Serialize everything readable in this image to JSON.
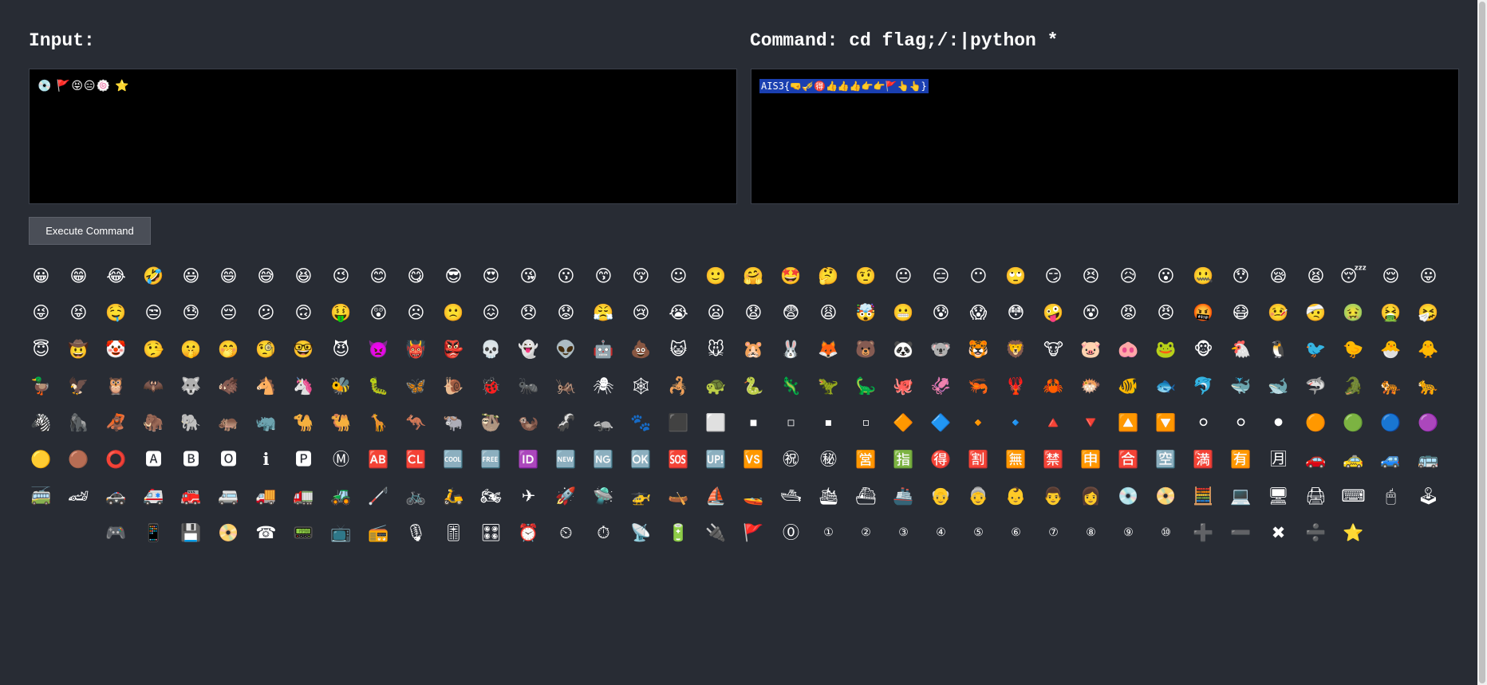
{
  "input_panel": {
    "title": "Input:",
    "value": "💿 🚩😝😑🍥 ⭐"
  },
  "command_panel": {
    "title": "Command: cd flag;/:|python *",
    "output": "AIS3{🤜🎺🉐👍👍👍👉👉🚩👆👆}"
  },
  "execute_button": {
    "label": "Execute Command"
  },
  "emoji_grid": [
    "😀",
    "😁",
    "😂",
    "🤣",
    "😃",
    "😄",
    "😅",
    "😆",
    "😉",
    "😊",
    "😋",
    "😎",
    "😍",
    "😘",
    "😗",
    "😙",
    "😚",
    "☺",
    "🙂",
    "🤗",
    "🤩",
    "🤔",
    "🤨",
    "😐",
    "😑",
    "😶",
    "🙄",
    "😏",
    "😣",
    "😥",
    "😮",
    "🤐",
    "😯",
    "😪",
    "😫",
    "😴",
    "😌",
    "😛",
    "😜",
    "😝",
    "🤤",
    "😒",
    "😓",
    "😔",
    "😕",
    "🙃",
    "🤑",
    "😲",
    "☹",
    "🙁",
    "😖",
    "😞",
    "😟",
    "😤",
    "😢",
    "😭",
    "😦",
    "😧",
    "😨",
    "😩",
    "🤯",
    "😬",
    "😰",
    "😱",
    "😳",
    "🤪",
    "😵",
    "😡",
    "😠",
    "🤬",
    "😷",
    "🤒",
    "🤕",
    "🤢",
    "🤮",
    "🤧",
    "😇",
    "🤠",
    "🤡",
    "🤥",
    "🤫",
    "🤭",
    "🧐",
    "🤓",
    "😈",
    "👿",
    "👹",
    "👺",
    "💀",
    "👻",
    "👽",
    "🤖",
    "💩",
    "😺",
    "🐭",
    "🐹",
    "🐰",
    "🦊",
    "🐻",
    "🐼",
    "🐨",
    "🐯",
    "🦁",
    "🐮",
    "🐷",
    "🐽",
    "🐸",
    "🐵",
    "🐔",
    "🐧",
    "🐦",
    "🐤",
    "🐣",
    "🐥",
    "🦆",
    "🦅",
    "🦉",
    "🦇",
    "🐺",
    "🐗",
    "🐴",
    "🦄",
    "🐝",
    "🐛",
    "🦋",
    "🐌",
    "🐞",
    "🐜",
    "🦗",
    "🕷",
    "🕸",
    "🦂",
    "🐢",
    "🐍",
    "🦎",
    "🦖",
    "🦕",
    "🐙",
    "🦑",
    "🦐",
    "🦞",
    "🦀",
    "🐡",
    "🐠",
    "🐟",
    "🐬",
    "🐳",
    "🐋",
    "🦈",
    "🐊",
    "🐅",
    "🐆",
    "🦓",
    "🦍",
    "🦧",
    "🦣",
    "🐘",
    "🦛",
    "🦏",
    "🐪",
    "🐫",
    "🦒",
    "🦘",
    "🐃",
    "🦥",
    "🦦",
    "🦨",
    "🦡",
    "🐾",
    "⬛",
    "⬜",
    "◾",
    "◽",
    "▪",
    "▫",
    "🔶",
    "🔷",
    "🔸",
    "🔹",
    "🔺",
    "🔻",
    "🔼",
    "🔽",
    "⚪",
    "⚪",
    "⚫",
    "🟠",
    "🟢",
    "🔵",
    "🟣",
    "🟡",
    "🟤",
    "⭕",
    "🅰",
    "🅱",
    "🅾",
    "ℹ",
    "🅿",
    "Ⓜ",
    "🆎",
    "🆑",
    "🆒",
    "🆓",
    "🆔",
    "🆕",
    "🆖",
    "🆗",
    "🆘",
    "🆙",
    "🆚",
    "㊗",
    "㊙",
    "🈺",
    "🈯",
    "🉐",
    "🈹",
    "🈚",
    "🈲",
    "🈸",
    "🈴",
    "🈳",
    "🈵",
    "🈶",
    "🈷",
    "🚗",
    "🚕",
    "🚙",
    "🚌",
    "🚎",
    "🏎",
    "🚓",
    "🚑",
    "🚒",
    "🚐",
    "🚚",
    "🚛",
    "🚜",
    "🦯",
    "🚲",
    "🛵",
    "🏍",
    "✈",
    "🚀",
    "🛸",
    "🚁",
    "🛶",
    "⛵",
    "🚤",
    "🛥",
    "🛳",
    "⛴",
    "🚢",
    "👴",
    "👵",
    "👶",
    "👨",
    "👩",
    "💿",
    "📀",
    "🧮",
    "💻",
    "🖥",
    "🖨",
    "⌨",
    "🖱",
    "🕹",
    "🎮",
    "📱",
    "💾",
    "📀",
    "☎",
    "📟",
    "📺",
    "📻",
    "🎙",
    "🎚",
    "🎛",
    "⏰",
    "⏲",
    "⏱",
    "📡",
    "🔋",
    "🔌",
    "🚩",
    "⓪",
    "①",
    "②",
    "③",
    "④",
    "⑤",
    "⑥",
    "⑦",
    "⑧",
    "⑨",
    "⑩",
    "➕",
    "➖",
    "✖",
    "➗",
    "⭐"
  ]
}
